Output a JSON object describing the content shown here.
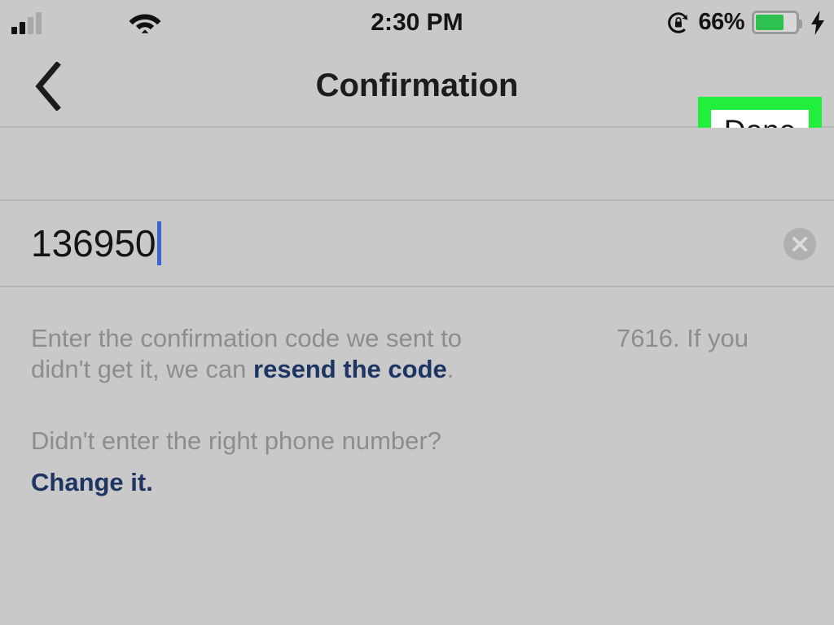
{
  "status_bar": {
    "time": "2:30 PM",
    "battery_percent": "66%",
    "battery_level": 66,
    "signal_bars_active": 2,
    "signal_bars_total": 4,
    "icons": {
      "signal": "cellular-signal-icon",
      "wifi": "wifi-icon",
      "rotation_lock": "rotation-lock-icon",
      "battery": "battery-icon",
      "charging": "lightning-bolt-icon"
    }
  },
  "nav_bar": {
    "back_label": "‹",
    "title": "Confirmation",
    "done_label": "Done",
    "highlight_color": "#22ee3c"
  },
  "form": {
    "code_value": "136950",
    "clear_label": "×"
  },
  "body": {
    "paragraph_1_before": "Enter the confirmation code we sent to",
    "paragraph_1_masked": "",
    "paragraph_1_after": "7616. If you didn't get it, we can ",
    "resend_link": "resend the code",
    "paragraph_1_end": ".",
    "paragraph_2": "Didn't enter the right phone number?",
    "change_link": "Change it."
  },
  "colors": {
    "background": "#c9c9c9",
    "link": "#1e3563",
    "muted_text": "#8d8d8d",
    "battery_fill": "#2ec14f",
    "caret": "#3c62d4"
  }
}
